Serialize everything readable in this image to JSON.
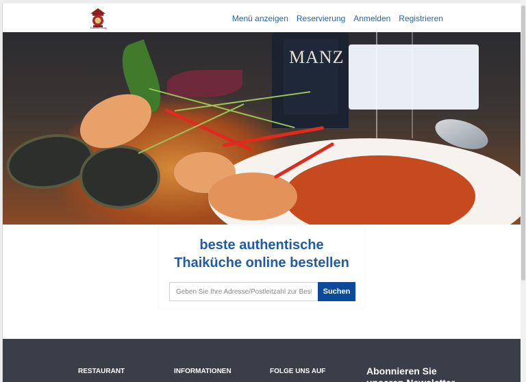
{
  "logo": {
    "icon": "restaurant-logo-icon",
    "text": "Buddha Chang"
  },
  "nav": {
    "items": [
      {
        "label": "Menü anzeigen"
      },
      {
        "label": "Reservierung"
      },
      {
        "label": "Anmelden"
      },
      {
        "label": "Registrieren"
      }
    ]
  },
  "hero": {
    "bottle_label": "MANZ"
  },
  "order": {
    "title_line1": "beste authentische",
    "title_line2": "Thaiküche online bestellen",
    "search_placeholder": "Geben Sie Ihre Adresse/Postleitzahl zur Bestellung ein",
    "search_button": "Suchen"
  },
  "footer": {
    "col1": "RESTAURANT",
    "col2": "INFORMATIONEN",
    "col3": "FOLGE UNS AUF",
    "newsletter": "Abonnieren Sie unseren Newsletter"
  },
  "colors": {
    "accent": "#1f5ca8",
    "button": "#0b4a9a",
    "footer": "#3a3e49"
  }
}
